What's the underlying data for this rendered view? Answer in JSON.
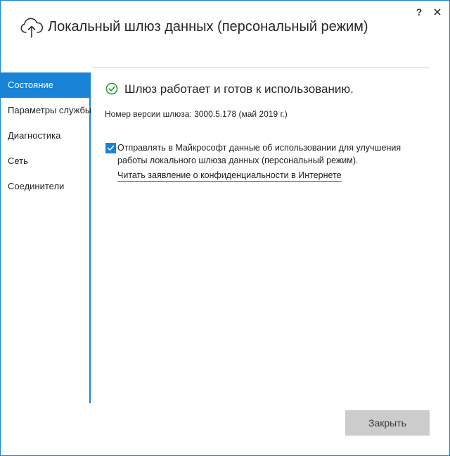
{
  "window": {
    "title": "Локальный шлюз данных (персональный режим)",
    "help_label": "?",
    "accent_color": "#1883d7"
  },
  "icons": {
    "app": "cloud-upload-icon",
    "status": "check-circle-icon",
    "close": "close-icon"
  },
  "sidebar": {
    "items": [
      {
        "label": "Состояние",
        "active": true
      },
      {
        "label": "Параметры службы",
        "active": false
      },
      {
        "label": "Диагностика",
        "active": false
      },
      {
        "label": "Сеть",
        "active": false
      },
      {
        "label": "Соединители",
        "active": false
      }
    ]
  },
  "main": {
    "status_text": "Шлюз работает и готов к использованию.",
    "status_color": "#2e9e3e",
    "version_text": "Номер версии шлюза: 3000.5.178 (май 2019 г.)",
    "consent": {
      "checked": true,
      "text": "Отправлять в Майкрософт данные об использовании для улучшения работы локального шлюза данных (персональный режим).",
      "link": "Читать заявление о конфиденциальности в Интернете"
    }
  },
  "footer": {
    "close_label": "Закрыть"
  }
}
